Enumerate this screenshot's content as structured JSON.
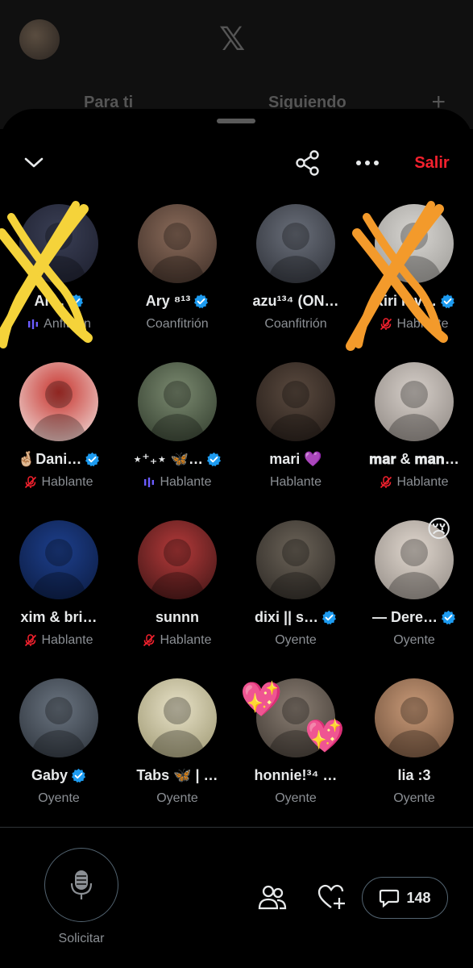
{
  "background": {
    "logo": "𝕏",
    "tabs": [
      "Para ti",
      "Siguiendo"
    ],
    "plus": "+"
  },
  "topbar": {
    "exit_label": "Salir",
    "icons": [
      "chevron-down-icon",
      "share-icon",
      "more-icon"
    ]
  },
  "participants": [
    {
      "name": "Ar…",
      "role": "Anfitrión",
      "verified": true,
      "role_icon": "audio-bars",
      "scribble": "#f5d33a"
    },
    {
      "name": "Ary ⁸¹³",
      "role": "Coanfitrión",
      "verified": true,
      "role_icon": ""
    },
    {
      "name": "azu¹³⁴ (ON…",
      "role": "Coanfitrión",
      "verified": false,
      "role_icon": ""
    },
    {
      "name": "Riri luv…",
      "role": "Hablante",
      "verified": true,
      "role_icon": "mic-muted",
      "scribble": "#f39a2b"
    },
    {
      "name": "🤞🏼Dani…",
      "role": "Hablante",
      "verified": true,
      "role_icon": "mic-muted"
    },
    {
      "name": "⋆⁺₊⋆ 🦋…",
      "role": "Hablante",
      "verified": true,
      "role_icon": "audio-bars"
    },
    {
      "name": "mari 💜",
      "role": "Hablante",
      "verified": false,
      "role_icon": ""
    },
    {
      "name": "𝐦𝐚𝐫 & 𝐦𝐚𝐧…",
      "role": "Hablante",
      "verified": false,
      "role_icon": "mic-muted"
    },
    {
      "name": "xim & bri…",
      "role": "Hablante",
      "verified": false,
      "role_icon": "mic-muted"
    },
    {
      "name": "sunnn",
      "role": "Hablante",
      "verified": false,
      "role_icon": "mic-muted"
    },
    {
      "name": "dixi || s…",
      "role": "Oyente",
      "verified": true,
      "role_icon": ""
    },
    {
      "name": "— Dere…",
      "role": "Oyente",
      "verified": true,
      "role_icon": "",
      "emoji": "😢"
    },
    {
      "name": "Gaby",
      "role": "Oyente",
      "verified": true,
      "role_icon": ""
    },
    {
      "name": "Tabs 🦋 | …",
      "role": "Oyente",
      "verified": false,
      "role_icon": ""
    },
    {
      "name": "honnie!³⁴ …",
      "role": "Oyente",
      "verified": false,
      "role_icon": "",
      "emoji": "💖"
    },
    {
      "name": "lia :3",
      "role": "Oyente",
      "verified": false,
      "role_icon": ""
    }
  ],
  "bottom": {
    "request_label": "Solicitar",
    "comments_count": "148"
  },
  "colors": {
    "accent_blue": "#1d9bf0",
    "exit_red": "#f4212e",
    "muted_red": "#f4212e",
    "muted_gray": "#8b8f94"
  }
}
